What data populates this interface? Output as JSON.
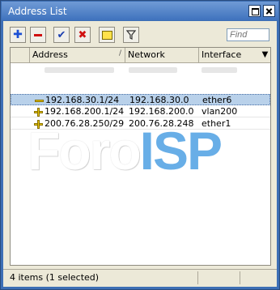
{
  "window": {
    "title": "Address List",
    "maximize_label": "",
    "close_label": ""
  },
  "toolbar": {
    "add_icon": "plus-icon",
    "remove_icon": "minus-icon",
    "enable_icon": "check-icon",
    "disable_icon": "x-icon",
    "comment_icon": "comment-icon",
    "filter_icon": "filter-icon",
    "find_placeholder": "Find"
  },
  "table": {
    "columns": [
      "",
      "Address",
      "Network",
      "Interface"
    ],
    "rows": [
      {
        "icon": "minus",
        "address": "192.168.30.1/24",
        "network": "192.168.30.0",
        "interface": "ether6",
        "selected": true
      },
      {
        "icon": "plus",
        "address": "192.168.200.1/24",
        "network": "192.168.200.0",
        "interface": "vlan200",
        "selected": false
      },
      {
        "icon": "plus",
        "address": "200.76.28.250/29",
        "network": "200.76.28.248",
        "interface": "ether1",
        "selected": false
      }
    ]
  },
  "watermark": {
    "part1": "Foro",
    "part2": "ISP"
  },
  "status": {
    "text": "4 items (1 selected)"
  },
  "colors": {
    "titlebar": "#3f72bd",
    "selection": "#b9d1ea",
    "watermark_accent": "#4ea0e3"
  }
}
